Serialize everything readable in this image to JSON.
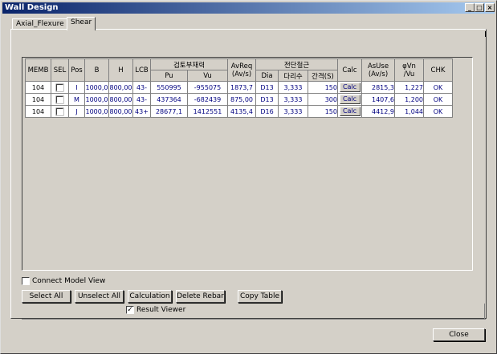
{
  "window": {
    "title": "Wall Design",
    "min_glyph": "_",
    "max_glyph": "□",
    "close_glyph": "×"
  },
  "tabs": [
    {
      "label": "Axial_Flexure",
      "active": false
    },
    {
      "label": "Shear",
      "active": true
    }
  ],
  "table": {
    "headers": {
      "memb": "MEMB",
      "sel": "SEL",
      "pos": "Pos",
      "b": "B",
      "h": "H",
      "lcb": "LCB",
      "check_force": "검토부재력",
      "pu": "Pu",
      "vu": "Vu",
      "avreq": "AvReq",
      "avreq_unit": "(Av/s)",
      "shear_rebar": "전단철근",
      "dia": "Dia",
      "legs": "다리수",
      "spacing": "간격(S)",
      "calc": "Calc",
      "asuse": "AsUse",
      "asuse_unit": "(Av/s)",
      "phivn": "φVn",
      "phivn_unit": "/Vu",
      "chk": "CHK"
    },
    "rows": [
      {
        "memb": "104",
        "pos": "I",
        "b": "1000,0",
        "h": "800,00",
        "lcb": "43-",
        "pu": "550995",
        "vu": "-955075",
        "avreq": "1873,7",
        "dia": "D13",
        "legs": "3,333",
        "spacing": "150",
        "calc": "Calc",
        "asuse": "2815,3",
        "phivn": "1,227",
        "chk": "OK"
      },
      {
        "memb": "104",
        "pos": "M",
        "b": "1000,0",
        "h": "800,00",
        "lcb": "43-",
        "pu": "437364",
        "vu": "-682439",
        "avreq": "875,00",
        "dia": "D13",
        "legs": "3,333",
        "spacing": "300",
        "calc": "Calc",
        "asuse": "1407,6",
        "phivn": "1,200",
        "chk": "OK"
      },
      {
        "memb": "104",
        "pos": "J",
        "b": "1000,0",
        "h": "800,00",
        "lcb": "43+",
        "pu": "28677,1",
        "vu": "1412551",
        "avreq": "4135,4",
        "dia": "D16",
        "legs": "3,333",
        "spacing": "150",
        "calc": "Calc",
        "asuse": "4412,9",
        "phivn": "1,044",
        "chk": "OK"
      }
    ]
  },
  "options": {
    "connect_model_view": "Connect Model View",
    "result_viewer": "Result Viewer",
    "result_viewer_mark": "✓"
  },
  "buttons": {
    "select_all": "Select All",
    "unselect_all": "Unselect All",
    "calculation": "Calculation",
    "delete_rebar": "Delete Rebar",
    "copy_table": "Copy Table",
    "close": "Close"
  }
}
